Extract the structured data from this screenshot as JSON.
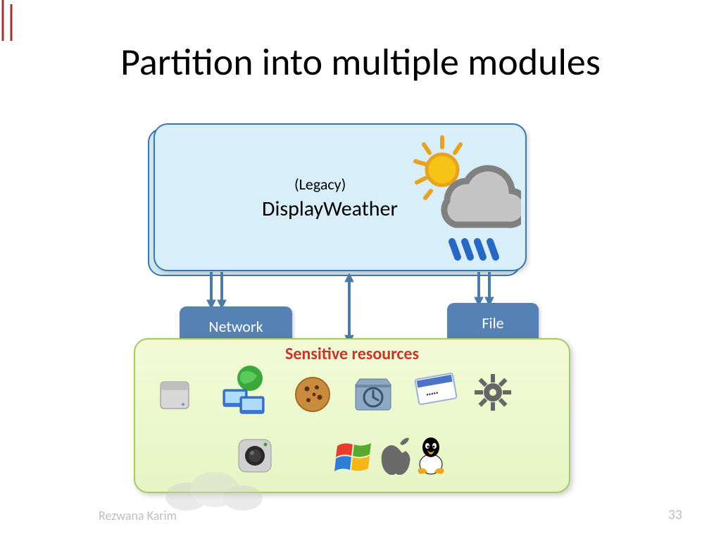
{
  "title": "Partition into multiple modules",
  "topModule": {
    "tag": "(Legacy)",
    "name": "DisplayWeather"
  },
  "modules": {
    "network": "Network",
    "file": "File"
  },
  "sensitive": {
    "title": "Sensitive resources",
    "row1": [
      "disk-icon",
      "network-globe-icon",
      "cookie-icon",
      "time-machine-icon",
      "password-icon",
      "gear-icon"
    ],
    "row2": [
      "camera-icon",
      "windows-icon",
      "apple-icon",
      "linux-icon"
    ]
  },
  "footer": {
    "author": "Rezwana Karim",
    "page": "33"
  }
}
